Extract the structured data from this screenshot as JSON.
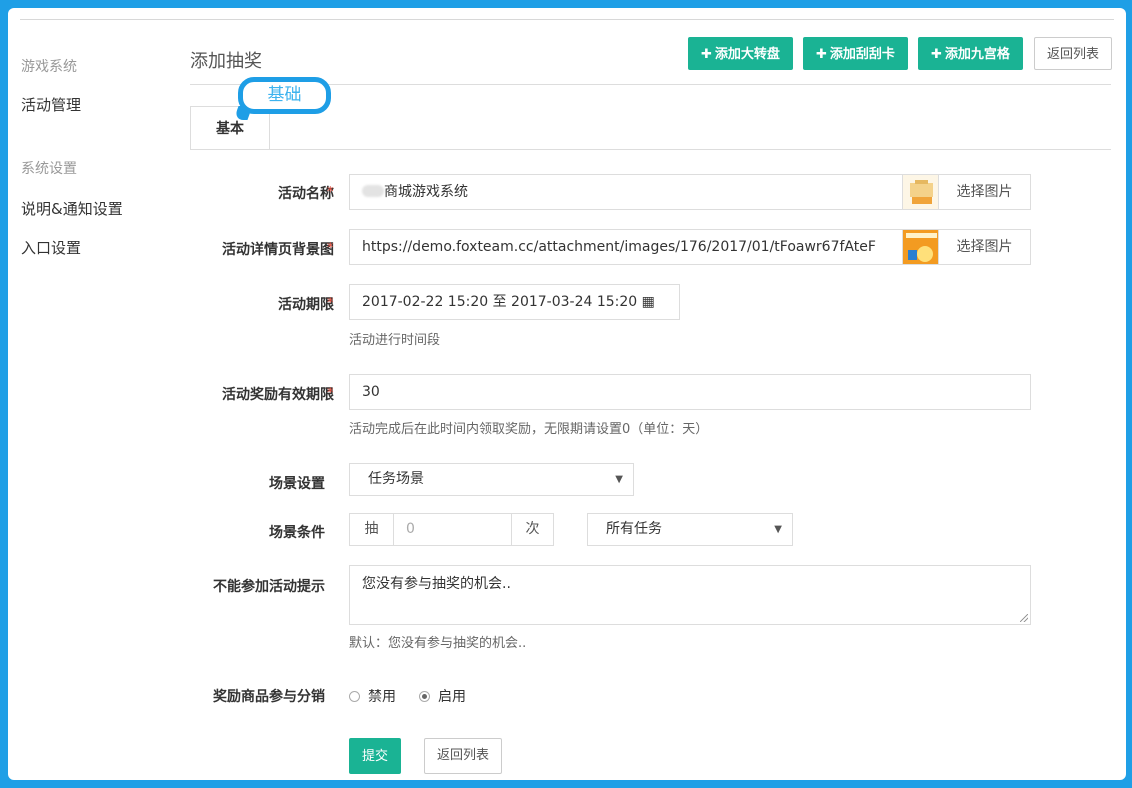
{
  "sidebar": {
    "group1": "游戏系统",
    "item_activity": "活动管理",
    "group2": "系统设置",
    "item_notice": "说明&通知设置",
    "item_entry": "入口设置"
  },
  "header": {
    "title": "添加抽奖",
    "btn_wheel": "添加大转盘",
    "btn_scratch": "添加刮刮卡",
    "btn_grid": "添加九宫格",
    "btn_back": "返回列表"
  },
  "tabs": {
    "basic": "基本"
  },
  "annotation": {
    "bubble": "基础"
  },
  "form": {
    "name": {
      "label": "活动名称",
      "value": "商城游戏系统",
      "button": "选择图片"
    },
    "bg": {
      "label": "活动详情页背景图",
      "value": "https://demo.foxteam.cc/attachment/images/176/2017/01/tFoawr67fAteF",
      "button": "选择图片"
    },
    "period": {
      "label": "活动期限",
      "value": "2017-02-22 15:20 至 2017-03-24 15:20",
      "help": "活动进行时间段"
    },
    "reward_limit": {
      "label": "活动奖励有效期限",
      "value": "30",
      "help": "活动完成后在此时间内领取奖励，无限期请设置0（单位：天）"
    },
    "scene": {
      "label": "场景设置",
      "value": "任务场景"
    },
    "condition": {
      "label": "场景条件",
      "prefix": "抽",
      "placeholder": "0",
      "suffix": "次",
      "task": "所有任务"
    },
    "notice": {
      "label": "不能参加活动提示",
      "value": "您没有参与抽奖的机会..",
      "help": "默认：您没有参与抽奖的机会.."
    },
    "distribution": {
      "label": "奖励商品参与分销",
      "opt_disable": "禁用",
      "opt_enable": "启用"
    },
    "submit": "提交",
    "back": "返回列表"
  },
  "required_mark": "*",
  "colors": {
    "accent": "#1ab394",
    "frame": "#1f9fe6",
    "required": "#e74c3c"
  }
}
